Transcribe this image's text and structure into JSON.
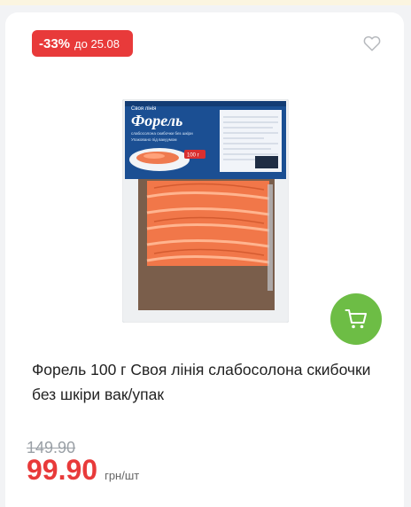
{
  "badge": {
    "discount": "-33%",
    "until": "до 25.08",
    "color": "#e83a3a"
  },
  "favorite": {
    "icon": "heart-outline-icon"
  },
  "product": {
    "title": "Форель 100 г Своя лінія слабосолона скибочки без шкіри вак/упак",
    "image": {
      "brand": "Своя лінія",
      "name": "Форель",
      "subtitle_line1": "слабосолона скибочки без шкіри",
      "subtitle_line2": "Упаковано під вакуумом",
      "weight": "100 г"
    }
  },
  "cart": {
    "icon": "cart-icon",
    "color": "#6dbd45"
  },
  "price": {
    "old": "149.90",
    "current": "99.90",
    "unit": "грн/шт"
  }
}
